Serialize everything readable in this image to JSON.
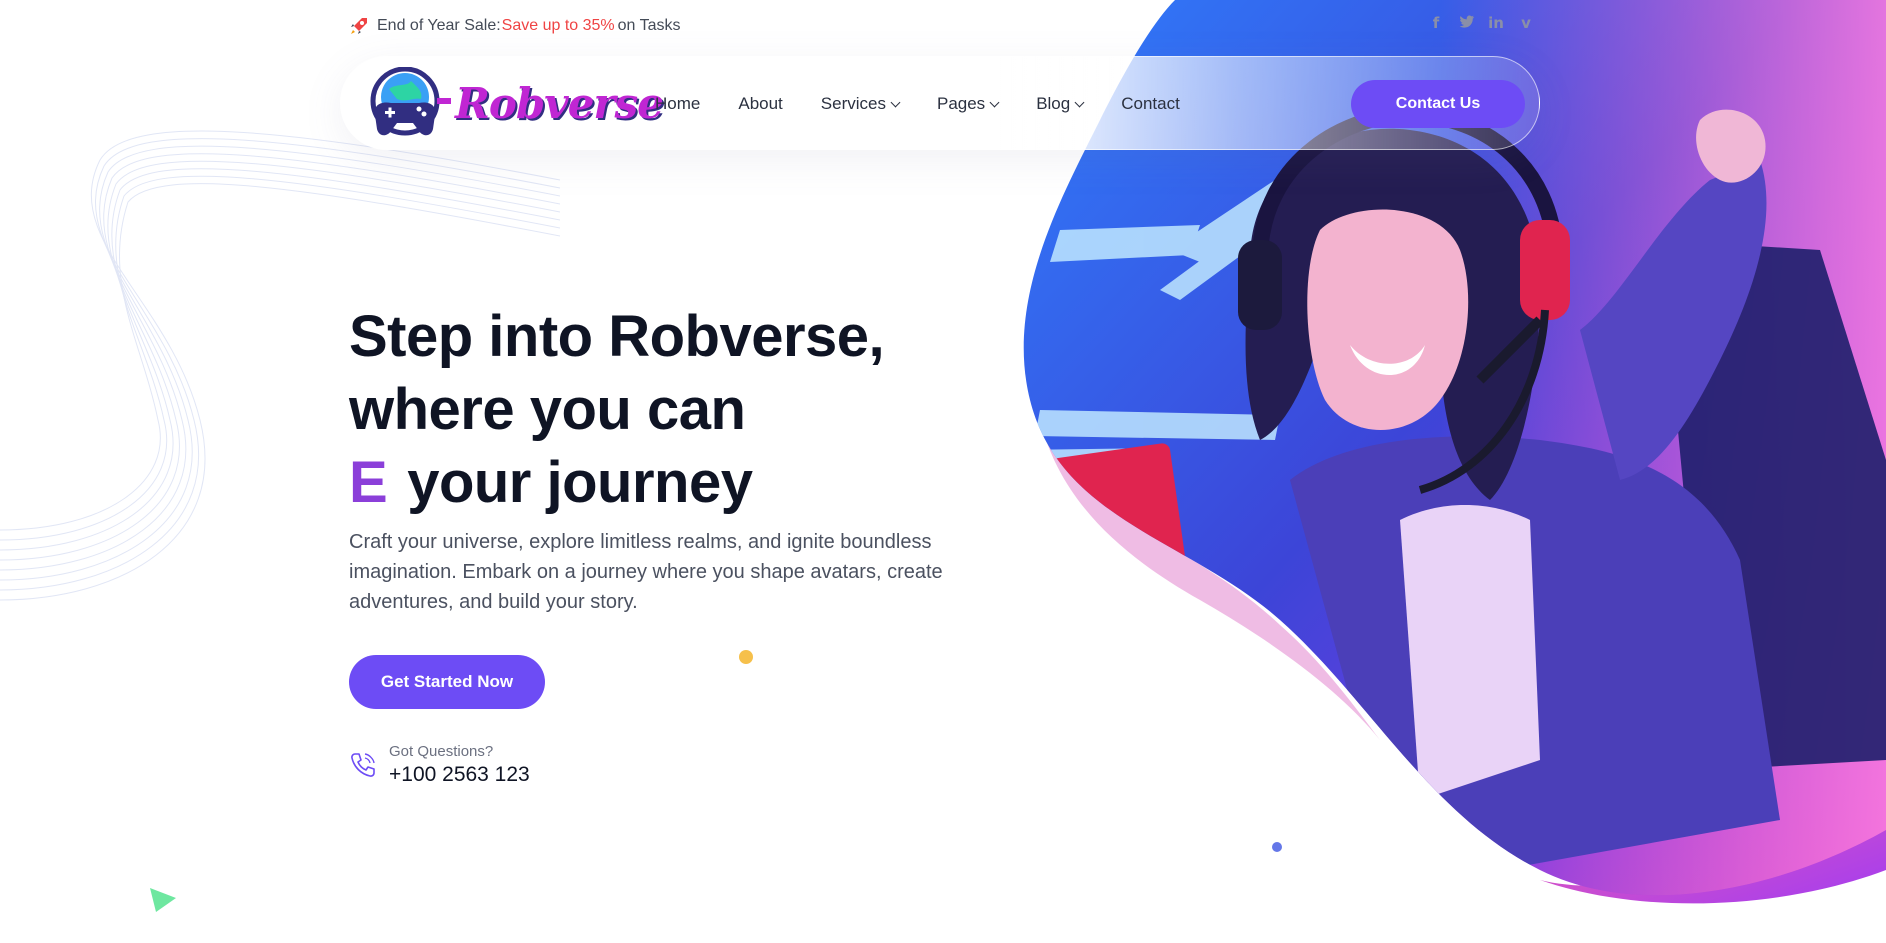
{
  "topbar": {
    "promo_prefix": "End of Year Sale:",
    "promo_highlight": "Save up to 35%",
    "promo_suffix": "on Tasks",
    "rocket_icon": "rocket-icon",
    "socials": [
      {
        "icon": "facebook-icon",
        "glyph": "f"
      },
      {
        "icon": "twitter-icon",
        "glyph": "t"
      },
      {
        "icon": "linkedin-icon",
        "glyph": "in"
      },
      {
        "icon": "vimeo-icon",
        "glyph": "v"
      }
    ]
  },
  "brand": {
    "name": "Robverse"
  },
  "nav": {
    "items": [
      {
        "label": "Home",
        "dropdown": false
      },
      {
        "label": "About",
        "dropdown": false
      },
      {
        "label": "Services",
        "dropdown": true
      },
      {
        "label": "Pages",
        "dropdown": true
      },
      {
        "label": "Blog",
        "dropdown": true
      },
      {
        "label": "Contact",
        "dropdown": false
      }
    ],
    "cta_label": "Contact Us"
  },
  "hero": {
    "title_line1": "Step into Robverse,",
    "title_line2": "where you can",
    "title_accent": "E",
    "title_line3": "your journey",
    "description": "Craft your universe, explore limitless realms, and ignite boundless imagination. Embark on a journey where you shape avatars, create adventures, and build your story.",
    "cta_label": "Get Started Now",
    "contact_question": "Got Questions?",
    "contact_phone": "+100 2563 123"
  },
  "colors": {
    "accent": "#6d4cf5",
    "sale": "#ef4444",
    "title_accent": "#8b3fd9",
    "dot_yellow": "#f6c04b",
    "dot_blue": "#6477e8",
    "triangle_green": "#6ee7a0"
  }
}
